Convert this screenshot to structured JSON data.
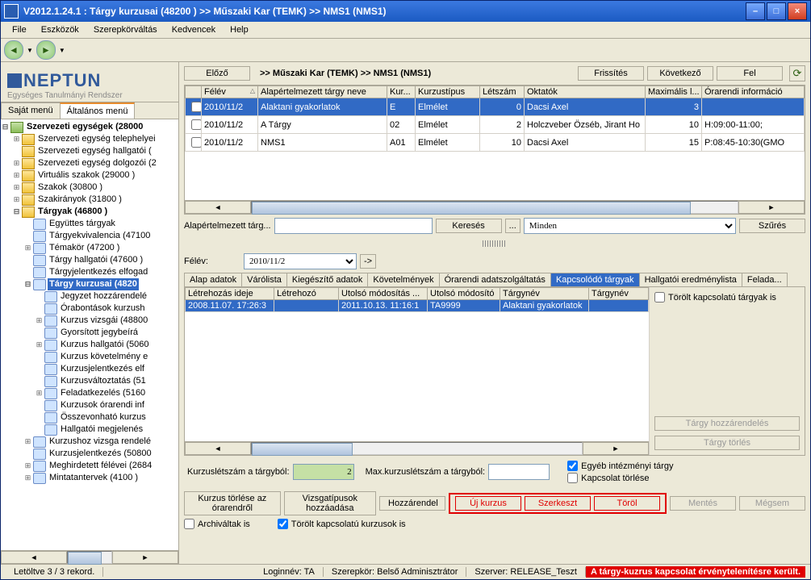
{
  "window": {
    "title": "V2012.1.24.1 : Tárgy kurzusai (48200  )  >> Műszaki Kar (TEMK) >> NMS1 (NMS1)"
  },
  "menu": {
    "file": "File",
    "tools": "Eszközök",
    "role": "Szerepkörváltás",
    "fav": "Kedvencek",
    "help": "Help"
  },
  "logo": {
    "brand": "NEPTUN",
    "tag": "Egységes Tanulmányi Rendszer"
  },
  "lefttabs": {
    "own": "Saját menü",
    "gen": "Általános menü"
  },
  "tree": {
    "root": "Szervezeti egységek (28000",
    "n1": "Szervezeti egység telephelyei",
    "n2": "Szervezeti egység hallgatói (",
    "n3": "Szervezeti egység dolgozói (2",
    "n4": "Virtuális szakok (29000  )",
    "n5": "Szakok (30800  )",
    "n6": "Szakirányok (31800  )",
    "n7": "Tárgyak (46800    )",
    "n7a": "Együttes tárgyak",
    "n7b": "Tárgyekvivalencia (47100",
    "n7c": "Témakör (47200  )",
    "n7d": "Tárgy hallgatói (47600  )",
    "n7e": "Tárgyjelentkezés elfogad",
    "n7f": "Tárgy kurzusai (4820",
    "n7f1": "Jegyzet hozzárendelé",
    "n7f2": "Órabontások kurzush",
    "n7f3": "Kurzus vizsgái (48800",
    "n7f4": "Gyorsított jegybeírá",
    "n7f5": "Kurzus hallgatói (5060",
    "n7f6": "Kurzus követelmény e",
    "n7f7": "Kurzusjelentkezés elf",
    "n7f8": "Kurzusváltoztatás (51",
    "n7f9": "Feladatkezelés (5160",
    "n7f10": "Kurzusok órarendi inf",
    "n7f11": "Összevonható kurzus",
    "n7f12": "Hallgatói megjelenés",
    "n7g": "Kurzushoz vizsga rendelé",
    "n7h": "Kurzusjelentkezés (50800",
    "n7i": "Meghirdetett félévei (2684",
    "n7j": "Mintatantervek (4100  )"
  },
  "toolbar": {
    "prev": "Előző",
    "next": "Következő",
    "refresh": "Frissítés",
    "up": "Fel",
    "crumb": ">> Műszaki Kar (TEMK) >> NMS1 (NMS1)"
  },
  "grid1": {
    "h_felev": "Félév",
    "h_nev": "Alapértelmezett tárgy neve",
    "h_kur": "Kur...",
    "h_tip": "Kurzustípus",
    "h_let": "Létszám",
    "h_okt": "Oktatók",
    "h_max": "Maximális l...",
    "h_ora": "Órarendi információ",
    "r1": {
      "felev": "2010/11/2",
      "nev": "Alaktani gyakorlatok",
      "kur": "E",
      "tip": "Elmélet",
      "let": "0",
      "okt": "Dacsi Axel",
      "max": "3",
      "ora": ""
    },
    "r2": {
      "felev": "2010/11/2",
      "nev": "A Tárgy",
      "kur": "02",
      "tip": "Elmélet",
      "let": "2",
      "okt": "Holczveber Özséb, Jirant Ho",
      "max": "10",
      "ora": "H:09:00-11:00;"
    },
    "r3": {
      "felev": "2010/11/2",
      "nev": "NMS1",
      "kur": "A01",
      "tip": "Elmélet",
      "let": "10",
      "okt": "Dacsi Axel",
      "max": "15",
      "ora": "P:08:45-10:30(GMO"
    }
  },
  "search": {
    "label": "Alapértelmezett tárg...",
    "btn": "Keresés",
    "all": "Minden",
    "filter": "Szűrés",
    "dots": "..."
  },
  "felev": {
    "label": "Félév:",
    "value": "2010/11/2"
  },
  "dtabs": {
    "t1": "Alap adatok",
    "t2": "Várólista",
    "t3": "Kiegészítő adatok",
    "t4": "Követelmények",
    "t5": "Órarendi adatszolgáltatás",
    "t6": "Kapcsolódó tárgyak",
    "t7": "Hallgatói eredménylista",
    "t8": "Felada..."
  },
  "grid2": {
    "h1": "Létrehozás ideje",
    "h2": "Létrehozó",
    "h3": "Utolsó módosítás ...",
    "h4": "Utolsó módosító",
    "h5": "Tárgynév",
    "h6": "Tárgynév",
    "r1": {
      "c1": "2008.11.07. 17:26:3",
      "c2": "",
      "c3": "2011.10.13. 11:16:1",
      "c4": "TA9999",
      "c5": "Alaktani gyakorlatok",
      "c6": ""
    }
  },
  "side": {
    "deleted": "Törölt kapcsolatú tárgyak is",
    "assign": "Tárgy hozzárendelés",
    "delete": "Tárgy törlés"
  },
  "bottom1": {
    "l1": "Kurzuslétszám a tárgyból:",
    "v1": "2",
    "l2": "Max.kurzuslétszám a tárgyból:",
    "v2": "",
    "cb1": "Egyéb intézményi tárgy",
    "cb2": "Kapcsolat törlése"
  },
  "bottom2": {
    "b1": "Kurzus törlése az órarendről",
    "b2": "Vizsgatípusok hozzáadása",
    "b3": "Hozzárendel",
    "b4": "Új kurzus",
    "b5": "Szerkeszt",
    "b6": "Töröl",
    "b7": "Mentés",
    "b8": "Mégsem",
    "cb1": "Archiváltak is",
    "cb2": "Törölt kapcsolatú kurzusok is"
  },
  "status": {
    "records": "Letöltve 3 / 3 rekord.",
    "login": "Loginnév: TA",
    "role": "Szerepkör: Belső Adminisztrátor",
    "server": "Szerver: RELEASE_Teszt",
    "alert": "A tárgy-kuzrus kapcsolat érvénytelenítésre került."
  }
}
